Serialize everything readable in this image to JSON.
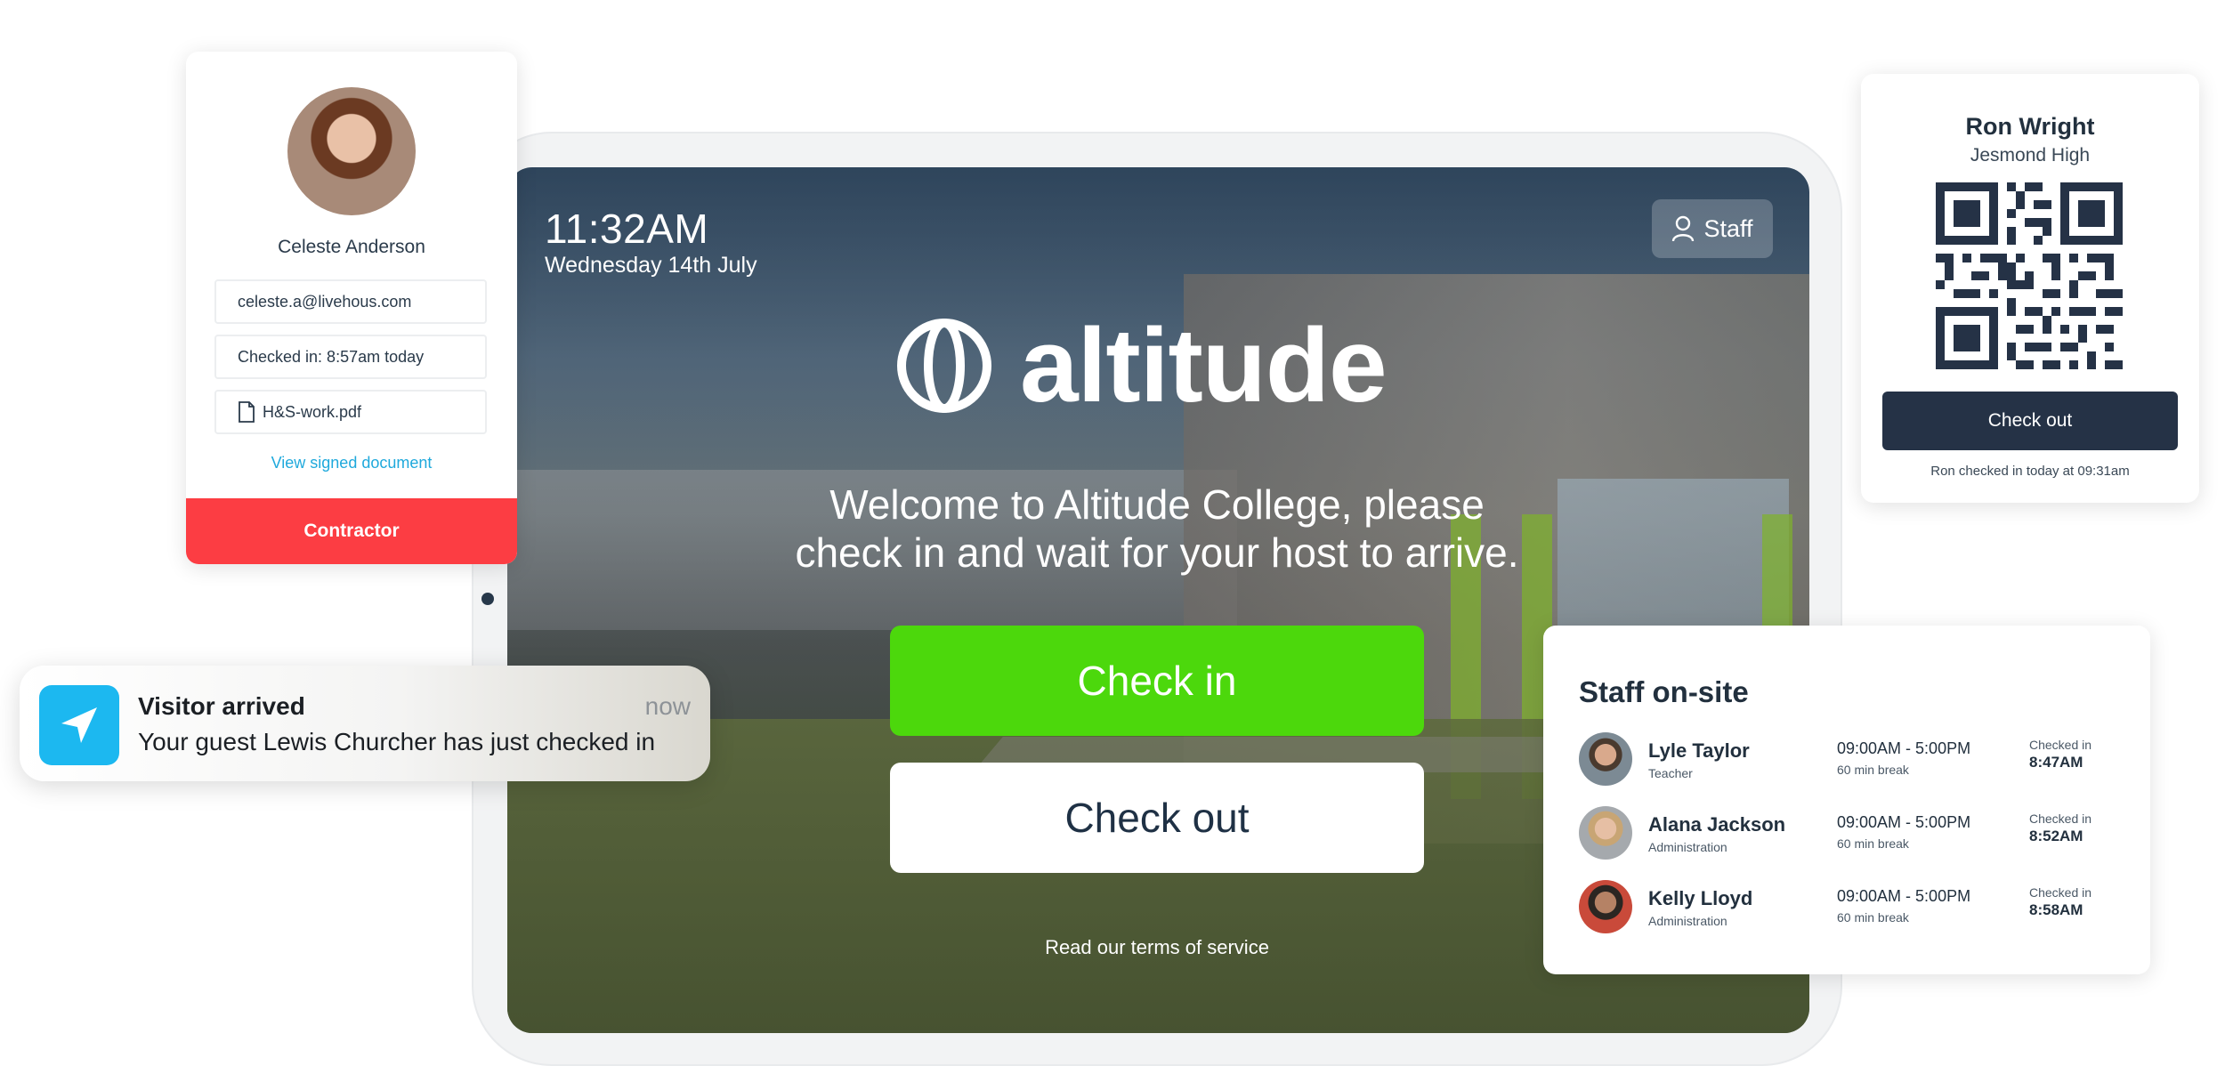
{
  "kiosk": {
    "time": "11:32AM",
    "date": "Wednesday 14th July",
    "staff_button": "Staff",
    "logo_text": "altitude",
    "welcome_line1": "Welcome to Altitude College, please",
    "welcome_line2": "check in and wait for your host to arrive.",
    "check_in_label": "Check in",
    "check_out_label": "Check out",
    "terms_link": "Read our terms of service",
    "check_in_color": "#4cd80c"
  },
  "visitor_card": {
    "name": "Celeste Anderson",
    "email": "celeste.a@livehous.com",
    "checked_in": "Checked in: 8:57am today",
    "document": "H&S-work.pdf",
    "document_icon": "file-icon",
    "view_link": "View signed document",
    "role": "Contractor",
    "role_color": "#fc3d43"
  },
  "notification": {
    "title": "Visitor arrived",
    "time": "now",
    "body": "Your guest Lewis Churcher has just checked in",
    "icon": "location-arrow-icon"
  },
  "badge_card": {
    "name": "Ron Wright",
    "school": "Jesmond High",
    "button": "Check out",
    "note": "Ron checked in today at 09:31am"
  },
  "staff_onsite": {
    "title": "Staff on-site",
    "staff": [
      {
        "name": "Lyle Taylor",
        "role": "Teacher",
        "hours": "09:00AM - 5:00PM",
        "break": "60 min break",
        "checked_in_label": "Checked in",
        "checked_in_time": "8:47AM"
      },
      {
        "name": "Alana Jackson",
        "role": "Administration",
        "hours": "09:00AM - 5:00PM",
        "break": "60 min break",
        "checked_in_label": "Checked in",
        "checked_in_time": "8:52AM"
      },
      {
        "name": "Kelly Lloyd",
        "role": "Administration",
        "hours": "09:00AM - 5:00PM",
        "break": "60 min break",
        "checked_in_label": "Checked in",
        "checked_in_time": "8:58AM"
      }
    ]
  }
}
